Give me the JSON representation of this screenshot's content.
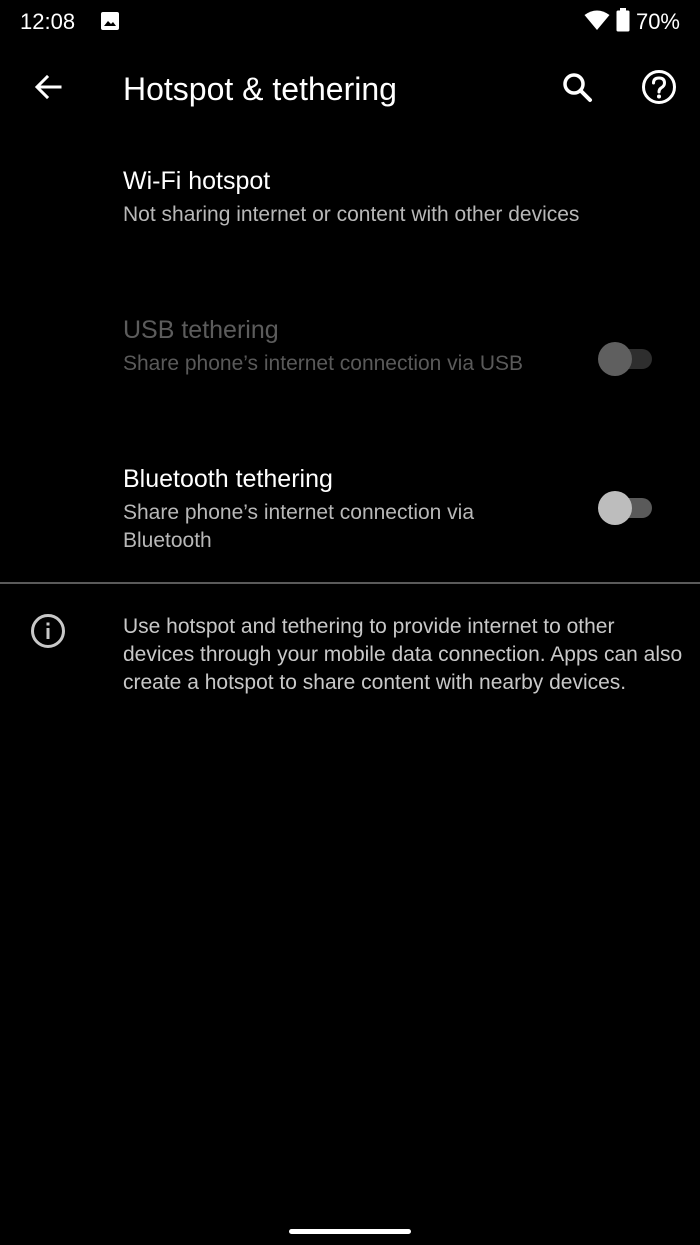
{
  "status_bar": {
    "time": "12:08",
    "battery": "70%",
    "icons": [
      "image-icon",
      "wifi-icon",
      "battery-icon"
    ]
  },
  "app_bar": {
    "title": "Hotspot & tethering",
    "icons": [
      "back-arrow-icon",
      "search-icon",
      "help-icon"
    ]
  },
  "settings": {
    "wifi_hotspot": {
      "title": "Wi-Fi hotspot",
      "summary": "Not sharing internet or content with other devices"
    },
    "usb_tethering": {
      "title": "USB tethering",
      "summary": "Share phone’s internet connection via USB",
      "enabled": false,
      "checked": false
    },
    "bluetooth_tethering": {
      "title": "Bluetooth tethering",
      "summary": "Share phone’s internet connection via Bluetooth",
      "enabled": true,
      "checked": false
    }
  },
  "footer_info": {
    "icon": "info-icon",
    "text": "Use hotspot and tethering to provide internet to other devices through your mobile data connection. Apps can also create a hotspot to share content with nearby devices."
  },
  "colors": {
    "background": "#000000",
    "primary_text": "#ffffff",
    "secondary_text": "#b8b8b8",
    "disabled_text": "#5c5c5c",
    "divider": "#5a5a5a"
  }
}
